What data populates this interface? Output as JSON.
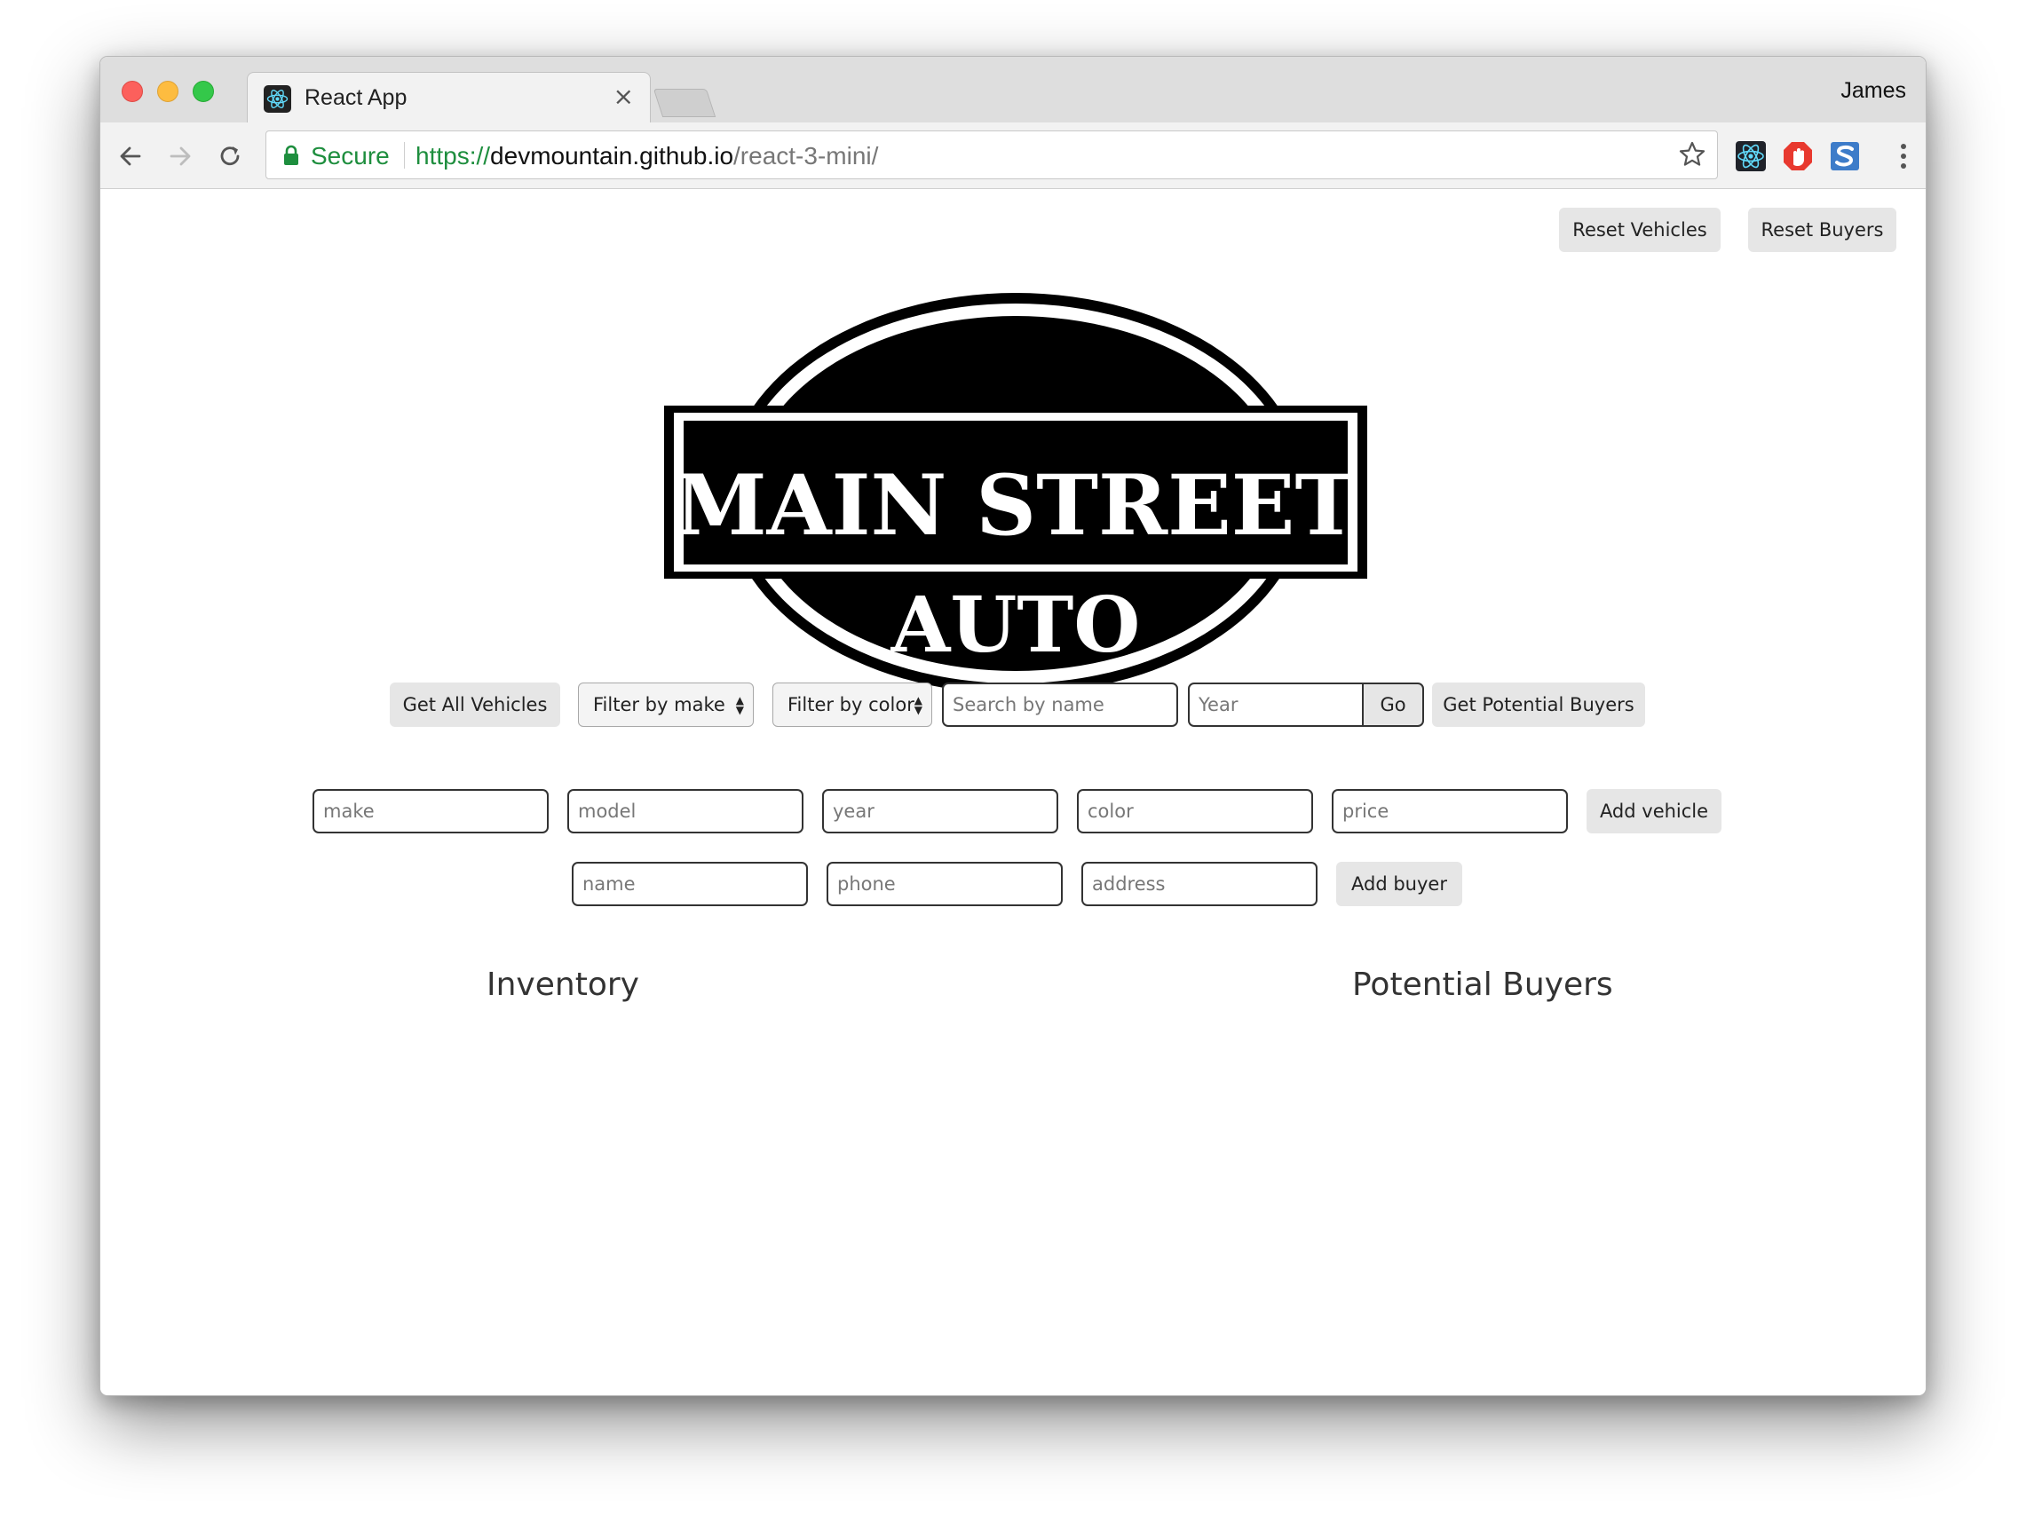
{
  "browser": {
    "tab_title": "React App",
    "tab_close": "×",
    "profile_name": "James",
    "secure_label": "Secure",
    "url_scheme": "https://",
    "url_host": "devmountain.github.io",
    "url_path": "/react-3-mini/"
  },
  "header_buttons": {
    "reset_vehicles": "Reset Vehicles",
    "reset_buyers": "Reset Buyers"
  },
  "logo": {
    "line1": "MAIN STREET",
    "line2": "AUTO"
  },
  "controls": {
    "get_all_vehicles": "Get All Vehicles",
    "filter_make": "Filter by make",
    "filter_color": "Filter by color",
    "search_placeholder": "Search by name",
    "year_placeholder": "Year",
    "go": "Go",
    "get_potential_buyers": "Get Potential Buyers"
  },
  "vehicle_form": {
    "make_placeholder": "make",
    "model_placeholder": "model",
    "year_placeholder": "year",
    "color_placeholder": "color",
    "price_placeholder": "price",
    "add_vehicle": "Add vehicle"
  },
  "buyer_form": {
    "name_placeholder": "name",
    "phone_placeholder": "phone",
    "address_placeholder": "address",
    "add_buyer": "Add buyer"
  },
  "sections": {
    "inventory": "Inventory",
    "potential_buyers": "Potential Buyers"
  },
  "icons": {
    "favicon": "react-icon",
    "back": "back-arrow-icon",
    "forward": "forward-arrow-icon",
    "reload": "reload-icon",
    "lock": "lock-icon",
    "bookmark": "star-icon",
    "menu": "more-vert-icon"
  }
}
